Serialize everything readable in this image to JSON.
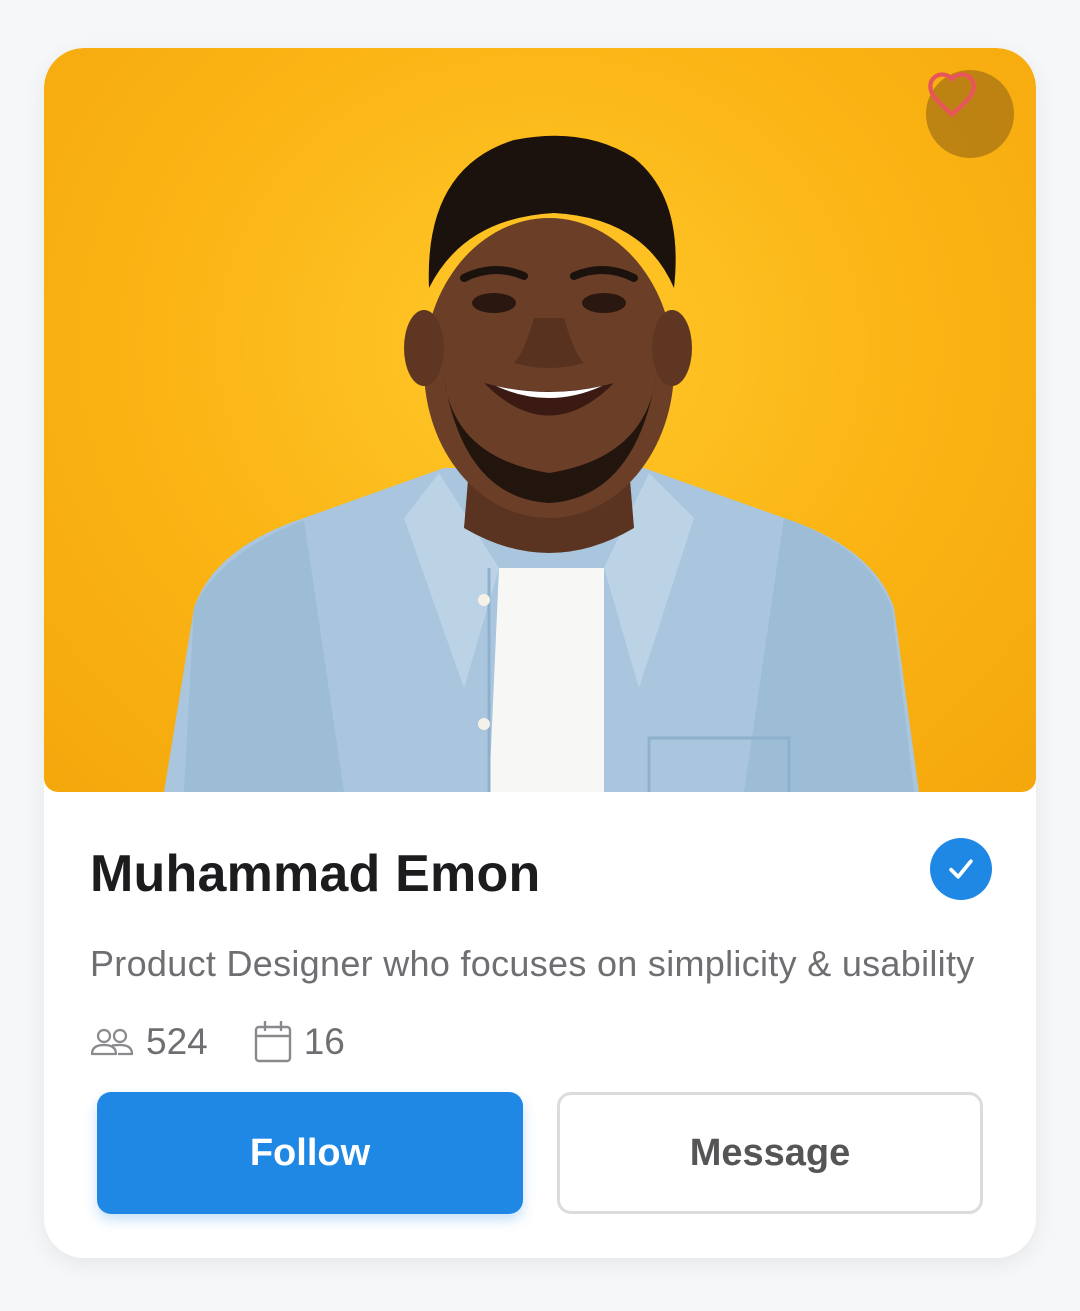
{
  "profile": {
    "name": "Muhammad Emon",
    "bio": "Product Designer who focuses on simplicity & usability",
    "followers": "524",
    "projects": "16",
    "verified": true
  },
  "actions": {
    "follow_label": "Follow",
    "message_label": "Message"
  },
  "icons": {
    "favorite": "heart-outline-icon",
    "verified": "check-badge-icon",
    "followers": "users-icon",
    "projects": "calendar-icon"
  },
  "colors": {
    "accent": "#1f88e5",
    "photo_background": "#fbb414",
    "heart": "#e8565b"
  }
}
